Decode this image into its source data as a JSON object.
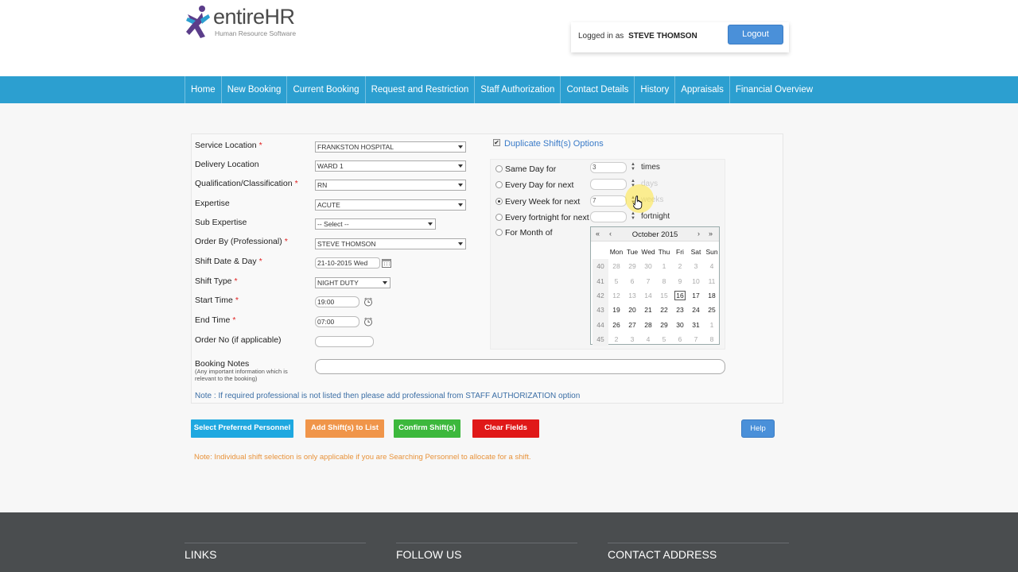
{
  "header": {
    "logo_text": "entireHR",
    "logo_tagline": "Human Resource Software",
    "logged_in_label": "Logged in as",
    "user_name": "STEVE THOMSON",
    "logout_label": "Logout"
  },
  "nav": {
    "items": [
      {
        "label": "Home"
      },
      {
        "label": "New Booking"
      },
      {
        "label": "Current Booking"
      },
      {
        "label": "Request and Restriction"
      },
      {
        "label": "Staff Authorization"
      },
      {
        "label": "Contact Details"
      },
      {
        "label": "History"
      },
      {
        "label": "Appraisals"
      },
      {
        "label": "Financial Overview"
      }
    ]
  },
  "form": {
    "service_location": {
      "label": "Service Location",
      "value": "FRANKSTON HOSPITAL"
    },
    "delivery_location": {
      "label": "Delivery Location",
      "value": "WARD 1"
    },
    "qualification": {
      "label": "Qualification/Classification",
      "value": "RN"
    },
    "expertise": {
      "label": "Expertise",
      "value": "ACUTE"
    },
    "sub_expertise": {
      "label": "Sub Expertise",
      "value": "-- Select --"
    },
    "order_by": {
      "label": "Order By (Professional)",
      "value": "STEVE THOMSON"
    },
    "shift_date": {
      "label": "Shift Date & Day",
      "value": "21-10-2015 Wed"
    },
    "shift_type": {
      "label": "Shift Type",
      "value": "NIGHT DUTY"
    },
    "start_time": {
      "label": "Start Time",
      "value": "19:00"
    },
    "end_time": {
      "label": "End Time",
      "value": "07:00"
    },
    "order_no": {
      "label": "Order No (if applicable)",
      "value": ""
    },
    "booking_notes": {
      "label": "Booking Notes",
      "hint": "(Any important information which is relevant to the booking)"
    },
    "required_mark": "*",
    "note": "Note : If required professional is not listed then please add professional from STAFF AUTHORIZATION option"
  },
  "duplicate": {
    "checkbox_label": "Duplicate Shift(s) Options",
    "checked": true,
    "options": [
      {
        "label": "Same Day for",
        "value": "3",
        "unit": "times",
        "selected": false
      },
      {
        "label": "Every Day for next",
        "value": "",
        "unit": "days",
        "selected": false
      },
      {
        "label": "Every Week for next",
        "value": "7",
        "unit": "weeks",
        "selected": true
      },
      {
        "label": "Every fortnight for next",
        "value": "",
        "unit": "fortnight",
        "selected": false
      },
      {
        "label": "For Month of",
        "value": "",
        "unit": "",
        "selected": false
      }
    ]
  },
  "calendar": {
    "title": "October 2015",
    "prev_year": "«",
    "prev_month": "‹",
    "next_month": "›",
    "next_year": "»",
    "weekdays": [
      "Mon",
      "Tue",
      "Wed",
      "Thu",
      "Fri",
      "Sat",
      "Sun"
    ],
    "weeks": [
      {
        "week": "40",
        "days": [
          "28",
          "29",
          "30",
          "1",
          "2",
          "3",
          "4"
        ]
      },
      {
        "week": "41",
        "days": [
          "5",
          "6",
          "7",
          "8",
          "9",
          "10",
          "11"
        ]
      },
      {
        "week": "42",
        "days": [
          "12",
          "13",
          "14",
          "15",
          "16",
          "17",
          "18"
        ]
      },
      {
        "week": "43",
        "days": [
          "19",
          "20",
          "21",
          "22",
          "23",
          "24",
          "25"
        ]
      },
      {
        "week": "44",
        "days": [
          "26",
          "27",
          "28",
          "29",
          "30",
          "31",
          "1"
        ]
      },
      {
        "week": "45",
        "days": [
          "2",
          "3",
          "4",
          "5",
          "6",
          "7",
          "8"
        ]
      }
    ],
    "today": "16"
  },
  "buttons": {
    "select_preferred": "Select Preferred Personnel",
    "add_shifts": "Add Shift(s) to List",
    "confirm_shifts": "Confirm Shift(s)",
    "clear_fields": "Clear Fields",
    "help": "Help"
  },
  "bottom_note": "Note: Individual shift selection is only applicable if you are Searching Personnel to allocate for a shift.",
  "footer": {
    "links": "LINKS",
    "follow_us": "FOLLOW US",
    "contact": "CONTACT ADDRESS"
  },
  "colors": {
    "nav_bg": "#2c9fd0",
    "btn_select": "#1ea8e0",
    "btn_add": "#f0954a",
    "btn_confirm": "#3cb83c",
    "btn_clear": "#e01818",
    "btn_help": "#4a90d9",
    "footer_bg": "#4a4d4f"
  }
}
